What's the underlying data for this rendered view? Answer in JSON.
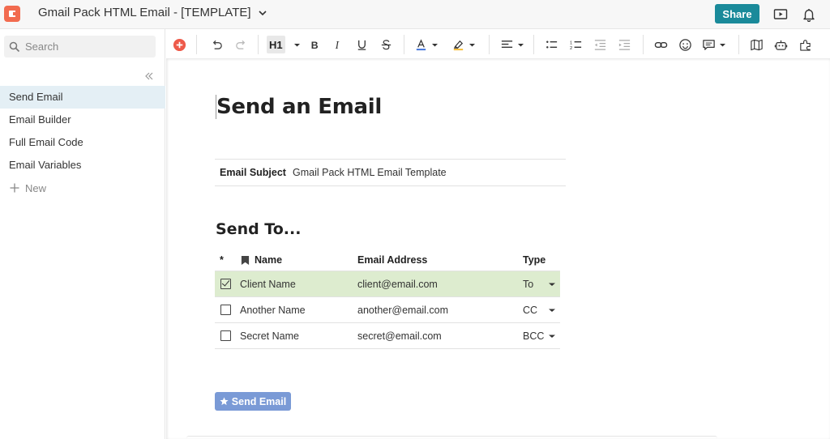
{
  "header": {
    "doc_title": "Gmail Pack HTML Email - [TEMPLATE]",
    "share_label": "Share",
    "icons": [
      "coda-logo-icon",
      "chevron-down-icon",
      "present-icon",
      "bell-icon"
    ]
  },
  "sidebar": {
    "search_placeholder": "Search",
    "items": [
      {
        "label": "Send Email",
        "active": true
      },
      {
        "label": "Email Builder",
        "active": false
      },
      {
        "label": "Full Email Code",
        "active": false
      },
      {
        "label": "Email Variables",
        "active": false
      }
    ],
    "new_label": "New"
  },
  "toolbar": {
    "heading_label": "H1",
    "icons": [
      "insert-icon",
      "undo-icon",
      "redo-icon",
      "heading-icon",
      "bold-icon",
      "italic-icon",
      "underline-icon",
      "strikethrough-icon",
      "text-color-icon",
      "highlight-icon",
      "align-icon",
      "bulleted-list-icon",
      "numbered-list-icon",
      "outdent-icon",
      "indent-icon",
      "link-icon",
      "emoji-icon",
      "comment-icon",
      "explore-icon",
      "bot-icon",
      "packs-icon"
    ],
    "colors": {
      "insert": "#ee5a4a",
      "text_color_bar": "#3b6fd9",
      "highlight_bar": "#f5b82e"
    }
  },
  "page": {
    "title": "Send an Email",
    "subject_label": "Email Subject",
    "subject_value": "Gmail Pack HTML Email Template",
    "section_title": "Send To...",
    "table": {
      "columns": {
        "star": "*",
        "name": "Name",
        "email": "Email Address",
        "type": "Type"
      },
      "rows": [
        {
          "checked": true,
          "name": "Client Name",
          "email": "client@email.com",
          "type": "To"
        },
        {
          "checked": false,
          "name": "Another Name",
          "email": "another@email.com",
          "type": "CC"
        },
        {
          "checked": false,
          "name": "Secret Name",
          "email": "secret@email.com",
          "type": "BCC"
        }
      ]
    },
    "send_button_label": "Send Email"
  },
  "colors": {
    "accent": "#1a8a9a",
    "selected_row": "#ddeccf",
    "send_button": "#7a9ad6",
    "active_nav": "#e4eff5"
  }
}
